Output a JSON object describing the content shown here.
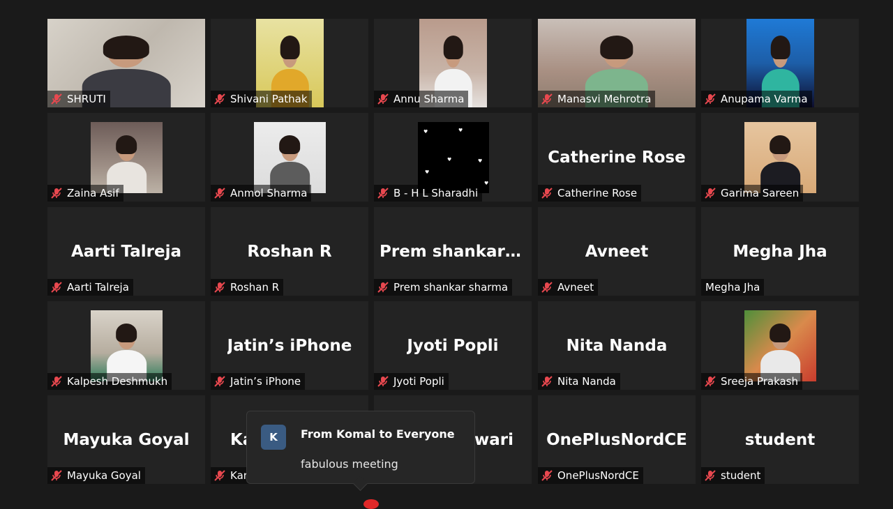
{
  "colors": {
    "background": "#1a1a1a",
    "tile": "#232323",
    "muted_mic": "#e8484f"
  },
  "tiles": [
    {
      "label": "SHRUTI"
    },
    {
      "label": "Shivani Pathak"
    },
    {
      "label": "Annu Sharma"
    },
    {
      "label": "Manasvi Mehrotra"
    },
    {
      "label": "Anupama Varma"
    },
    {
      "label": "Zaina Asif"
    },
    {
      "label": "Anmol Sharma"
    },
    {
      "label": "B - H L Sharadhi"
    },
    {
      "label": "Catherine Rose",
      "big": "Catherine Rose"
    },
    {
      "label": "Garima Sareen"
    },
    {
      "label": "Aarti Talreja",
      "big": "Aarti Talreja"
    },
    {
      "label": "Roshan R",
      "big": "Roshan R"
    },
    {
      "label": "Prem shankar sharma",
      "big": "Prem  shankar  s..."
    },
    {
      "label": "Avneet",
      "big": "Avneet"
    },
    {
      "label": "Megha Jha",
      "big": "Megha Jha"
    },
    {
      "label": "Kalpesh Deshmukh"
    },
    {
      "label": "Jatin’s iPhone",
      "big": "Jatin’s iPhone"
    },
    {
      "label": "Jyoti Popli",
      "big": "Jyoti Popli"
    },
    {
      "label": "Nita Nanda",
      "big": "Nita Nanda"
    },
    {
      "label": "Sreeja Prakash"
    },
    {
      "label": "Mayuka Goyal",
      "big": "Mayuka Goyal"
    },
    {
      "label": "Kar",
      "big": "Ka"
    },
    {
      "big": "wari"
    },
    {
      "label": "OnePlusNordCE",
      "big": "OnePlusNordCE"
    },
    {
      "label": "student",
      "big": "student"
    }
  ],
  "chat": {
    "avatar_letter": "K",
    "from": "From Komal to Everyone",
    "message": "fabulous meeting"
  }
}
